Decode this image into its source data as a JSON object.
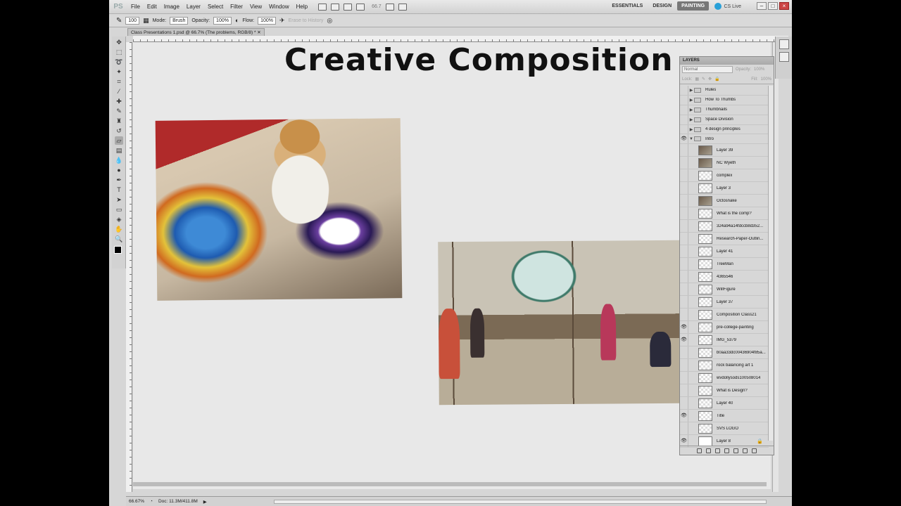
{
  "menubar": {
    "app_logo": "PS",
    "items": [
      "File",
      "Edit",
      "Image",
      "Layer",
      "Select",
      "Filter",
      "View",
      "Window",
      "Help"
    ],
    "zoom": "66.7",
    "workspaces": [
      "ESSENTIALS",
      "DESIGN",
      "PAINTING"
    ],
    "active_workspace": "PAINTING",
    "cs_live": "CS Live"
  },
  "options": {
    "brush_size": "100",
    "mode_label": "Mode:",
    "mode_value": "Brush",
    "opacity_label": "Opacity:",
    "opacity_value": "100%",
    "flow_label": "Flow:",
    "flow_value": "100%",
    "erase_to_history": "Erase to History"
  },
  "document": {
    "tab_title": "Class Presentations 1.psd @ 66.7% (The problems, RGB/8) *",
    "slide_title": "Creative Composition"
  },
  "layers_panel": {
    "title": "LAYERS",
    "blend_mode": "Normal",
    "opacity_label": "Opacity:",
    "opacity": "100%",
    "lock_label": "Lock:",
    "fill_label": "Fill:",
    "fill": "100%",
    "groups": [
      {
        "name": "Rules",
        "visible": false
      },
      {
        "name": "How To Thumbs",
        "visible": false
      },
      {
        "name": "Thumbnails",
        "visible": false
      },
      {
        "name": "Space Division",
        "visible": false
      },
      {
        "name": "4 design principles",
        "visible": false
      },
      {
        "name": "Intro",
        "visible": true
      }
    ],
    "layers": [
      {
        "name": "Layer 39",
        "visible": false,
        "thumb": "img"
      },
      {
        "name": "NC Wyeth",
        "visible": false,
        "thumb": "img"
      },
      {
        "name": "complex",
        "visible": false,
        "thumb": "checker"
      },
      {
        "name": "Layer 3",
        "visible": false,
        "thumb": "checker"
      },
      {
        "name": "Octosnake",
        "visible": false,
        "thumb": "img"
      },
      {
        "name": "What is the comp?",
        "visible": false,
        "thumb": "checker"
      },
      {
        "name": "324a94a14fdccb8d352...",
        "visible": false,
        "thumb": "checker"
      },
      {
        "name": "Research-Paper-Outlin...",
        "visible": false,
        "thumb": "checker"
      },
      {
        "name": "Layer 41",
        "visible": false,
        "thumb": "checker"
      },
      {
        "name": "TreeMan",
        "visible": false,
        "thumb": "checker"
      },
      {
        "name": "4365546",
        "visible": false,
        "thumb": "checker"
      },
      {
        "name": "WillFigure",
        "visible": false,
        "thumb": "checker"
      },
      {
        "name": "Layer 37",
        "visible": false,
        "thumb": "checker"
      },
      {
        "name": "Composition Class21",
        "visible": false,
        "thumb": "checker"
      },
      {
        "name": "pre-college-painting",
        "visible": true,
        "thumb": "checker"
      },
      {
        "name": "IMG_5379",
        "visible": true,
        "thumb": "checker"
      },
      {
        "name": "b0aa33dc00436904f85a...",
        "visible": false,
        "thumb": "checker"
      },
      {
        "name": "rock balancing art 1",
        "visible": false,
        "thumb": "checker"
      },
      {
        "name": "wvdollysods100508014",
        "visible": false,
        "thumb": "checker"
      },
      {
        "name": "What is Design?",
        "visible": false,
        "thumb": "checker"
      },
      {
        "name": "Layer 40",
        "visible": false,
        "thumb": "checker"
      },
      {
        "name": "Title",
        "visible": true,
        "thumb": "checker"
      },
      {
        "name": "SVS LOGO",
        "visible": false,
        "thumb": "checker"
      },
      {
        "name": "Layer 8",
        "visible": true,
        "thumb": "white"
      }
    ]
  },
  "status": {
    "zoom": "66.67%",
    "doc_size": "Doc: 11.3M/411.8M"
  }
}
